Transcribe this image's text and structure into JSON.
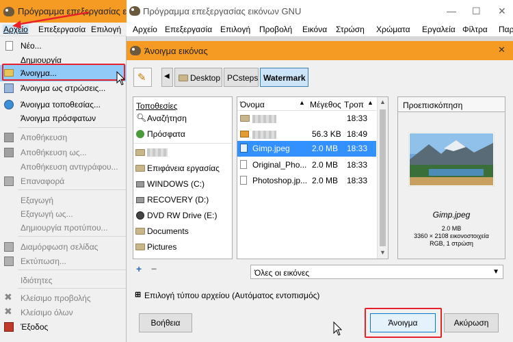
{
  "bg_window": {
    "title": "Πρόγραμμα επεξεργασίας εικ",
    "menu": [
      "Αρχείο",
      "Επεξεργασία",
      "Επιλογή"
    ]
  },
  "file_menu": [
    {
      "label": "Νέο...",
      "icon": "new-file-icon",
      "disabled": false
    },
    {
      "label": "Δημιουργία",
      "icon": "",
      "disabled": false
    },
    {
      "label": "Άνοιγμα...",
      "icon": "open-folder-icon",
      "disabled": false,
      "highlight": true
    },
    {
      "label": "Άνοιγμα ως στρώσεις...",
      "icon": "layers-icon",
      "disabled": false
    },
    {
      "label": "Άνοιγμα τοποθεσίας...",
      "icon": "globe-icon",
      "disabled": false
    },
    {
      "label": "Άνοιγμα πρόσφατων",
      "icon": "",
      "disabled": false
    },
    {
      "label": "Αποθήκευση",
      "icon": "save-icon",
      "disabled": true
    },
    {
      "label": "Αποθήκευση ως...",
      "icon": "save-as-icon",
      "disabled": true
    },
    {
      "label": "Αποθήκευση αντιγράφου...",
      "icon": "",
      "disabled": true
    },
    {
      "label": "Επαναφορά",
      "icon": "revert-icon",
      "disabled": true
    },
    {
      "label": "Εξαγωγή",
      "icon": "",
      "disabled": true
    },
    {
      "label": "Εξαγωγή ως...",
      "icon": "",
      "disabled": true
    },
    {
      "label": "Δημιουργία προτύπου...",
      "icon": "",
      "disabled": true
    },
    {
      "label": "Διαμόρφωση σελίδας",
      "icon": "page-setup-icon",
      "disabled": true
    },
    {
      "label": "Εκτύπωση...",
      "icon": "print-icon",
      "disabled": true
    },
    {
      "label": "Ιδιότητες",
      "icon": "",
      "disabled": true
    },
    {
      "label": "Κλείσιμο προβολής",
      "icon": "close-icon",
      "disabled": true
    },
    {
      "label": "Κλείσιμο όλων",
      "icon": "close-all-icon",
      "disabled": true
    },
    {
      "label": "Έξοδος",
      "icon": "exit-icon",
      "disabled": false
    }
  ],
  "main_window": {
    "title": "Πρόγραμμα επεξεργασίας εικόνων GNU",
    "menu": [
      "Αρχείο",
      "Επεξεργασία",
      "Επιλογή",
      "Προβολή",
      "Εικόνα",
      "Στρώση",
      "Χρώματα",
      "Εργαλεία",
      "Φίλτρα",
      "Παρ"
    ]
  },
  "dialog": {
    "title": "Άνοιγμα εικόνας",
    "breadcrumb": [
      "Desktop",
      "PCsteps",
      "Watermark"
    ],
    "places_header": "Τοποθεσίες",
    "places": [
      {
        "label": "Αναζήτηση",
        "icon": "search-icon"
      },
      {
        "label": "Πρόσφατα",
        "icon": "recent-icon"
      },
      {
        "label": "",
        "icon": "folder-icon",
        "blurred": true
      },
      {
        "label": "Επιφάνεια εργασίας",
        "icon": "folder-icon"
      },
      {
        "label": "WINDOWS (C:)",
        "icon": "drive-icon"
      },
      {
        "label": "RECOVERY (D:)",
        "icon": "drive-icon"
      },
      {
        "label": "DVD RW Drive (E:)",
        "icon": "dvd-icon"
      },
      {
        "label": "Documents",
        "icon": "folder-icon"
      },
      {
        "label": "Pictures",
        "icon": "folder-icon"
      }
    ],
    "columns": [
      "Όνομα",
      "Μέγεθος",
      "Τροπ"
    ],
    "files": [
      {
        "name": "",
        "size": "",
        "time": "18:33",
        "icon": "folder-icon",
        "blurred": true
      },
      {
        "name": "",
        "size": "56.3 KB",
        "time": "18:49",
        "icon": "image-icon",
        "blurred": true
      },
      {
        "name": "Gimp.jpeg",
        "size": "2.0 MB",
        "time": "18:33",
        "icon": "image-icon",
        "selected": true
      },
      {
        "name": "Original_Pho...",
        "size": "2.0 MB",
        "time": "18:33",
        "icon": "file-icon"
      },
      {
        "name": "Photoshop.jp...",
        "size": "2.0 MB",
        "time": "18:33",
        "icon": "file-icon"
      }
    ],
    "preview": {
      "header": "Προεπισκόπηση",
      "filename": "Gimp.jpeg",
      "size": "2.0 MB",
      "dims": "3360 × 2108 εικονοστοιχεία",
      "mode": "RGB, 1 στρώση"
    },
    "filter": "Όλες οι εικόνες",
    "file_type": "Επιλογή τύπου αρχείου (Αυτόματος εντοπισμός)",
    "help": "Βοήθεια",
    "open": "Άνοιγμα",
    "cancel": "Ακύρωση"
  },
  "colors": {
    "title_bar": "#f59a23",
    "selection": "#3390ff",
    "menu_highlight": "#91c9f7",
    "annotation_red": "#e8202a"
  }
}
